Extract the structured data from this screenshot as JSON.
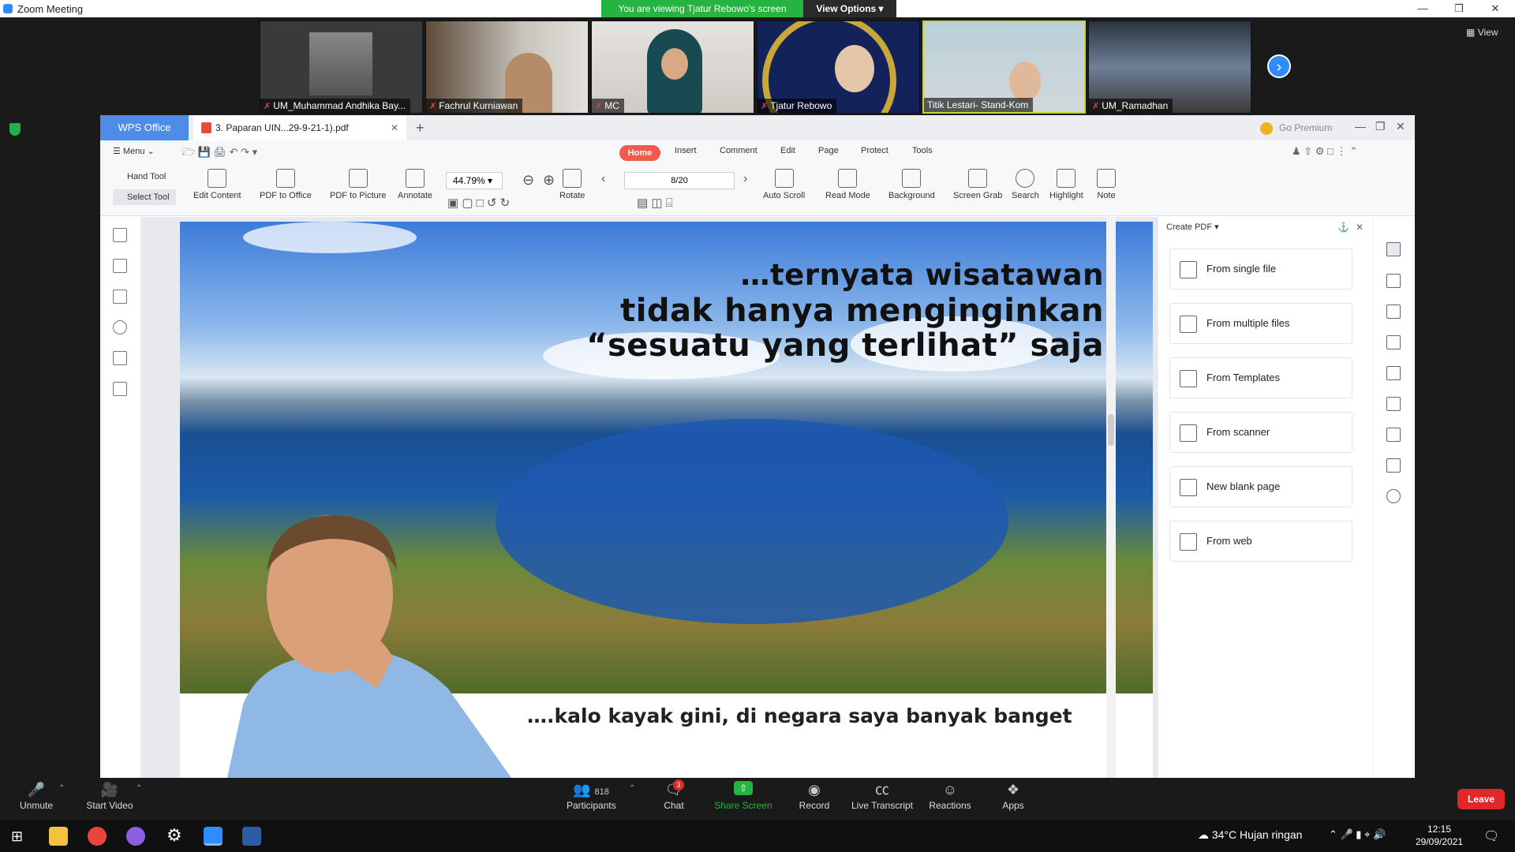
{
  "zoom": {
    "window_title": "Zoom Meeting",
    "banner": "You are viewing Tjatur Rebowo's screen",
    "view_options": "View Options",
    "view_label": "View",
    "participants": [
      {
        "name": "UM_Muhammad Andhika Bay..."
      },
      {
        "name": "Fachrul Kurniawan"
      },
      {
        "name": "MC"
      },
      {
        "name": "Tjatur Rebowo"
      },
      {
        "name": "Titik Lestari- Stand-Kom"
      },
      {
        "name": "UM_Ramadhan"
      }
    ],
    "bottom": {
      "unmute": "Unmute",
      "start_video": "Start Video",
      "participants_label": "Participants",
      "participants_count": "818",
      "chat": "Chat",
      "chat_badge": "3",
      "share_screen": "Share Screen",
      "record": "Record",
      "live_transcript": "Live Transcript",
      "reactions": "Reactions",
      "apps": "Apps",
      "leave": "Leave"
    }
  },
  "wps": {
    "brand": "WPS Office",
    "doc_tab": "3. Paparan UIN...29-9-21-1).pdf",
    "go_premium": "Go Premium",
    "menu": "Menu",
    "tabs": [
      "Home",
      "Insert",
      "Comment",
      "Edit",
      "Page",
      "Protect",
      "Tools"
    ],
    "hand_tool": "Hand Tool",
    "select_tool": "Select Tool",
    "ribbon": {
      "edit_content": "Edit Content",
      "pdf_to_office": "PDF to Office",
      "pdf_to_picture": "PDF to Picture",
      "annotate": "Annotate",
      "zoom": "44.79%",
      "rotate": "Rotate",
      "page": "8/20",
      "auto_scroll": "Auto Scroll",
      "read_mode": "Read Mode",
      "background": "Background",
      "screen_grab": "Screen Grab",
      "search": "Search",
      "highlight": "Highlight",
      "note": "Note"
    },
    "slide": {
      "line1": "…ternyata wisatawan",
      "line2": "tidak hanya menginginkan",
      "line3": "“sesuatu yang terlihat” saja",
      "caption": "….kalo kayak gini, di negara saya banyak banget"
    },
    "create_pdf": {
      "title": "Create PDF",
      "items": [
        "From single file",
        "From multiple files",
        "From Templates",
        "From scanner",
        "New blank page",
        "From web"
      ]
    }
  },
  "taskbar": {
    "weather": "34°C  Hujan ringan",
    "time": "12:15",
    "date": "29/09/2021"
  }
}
